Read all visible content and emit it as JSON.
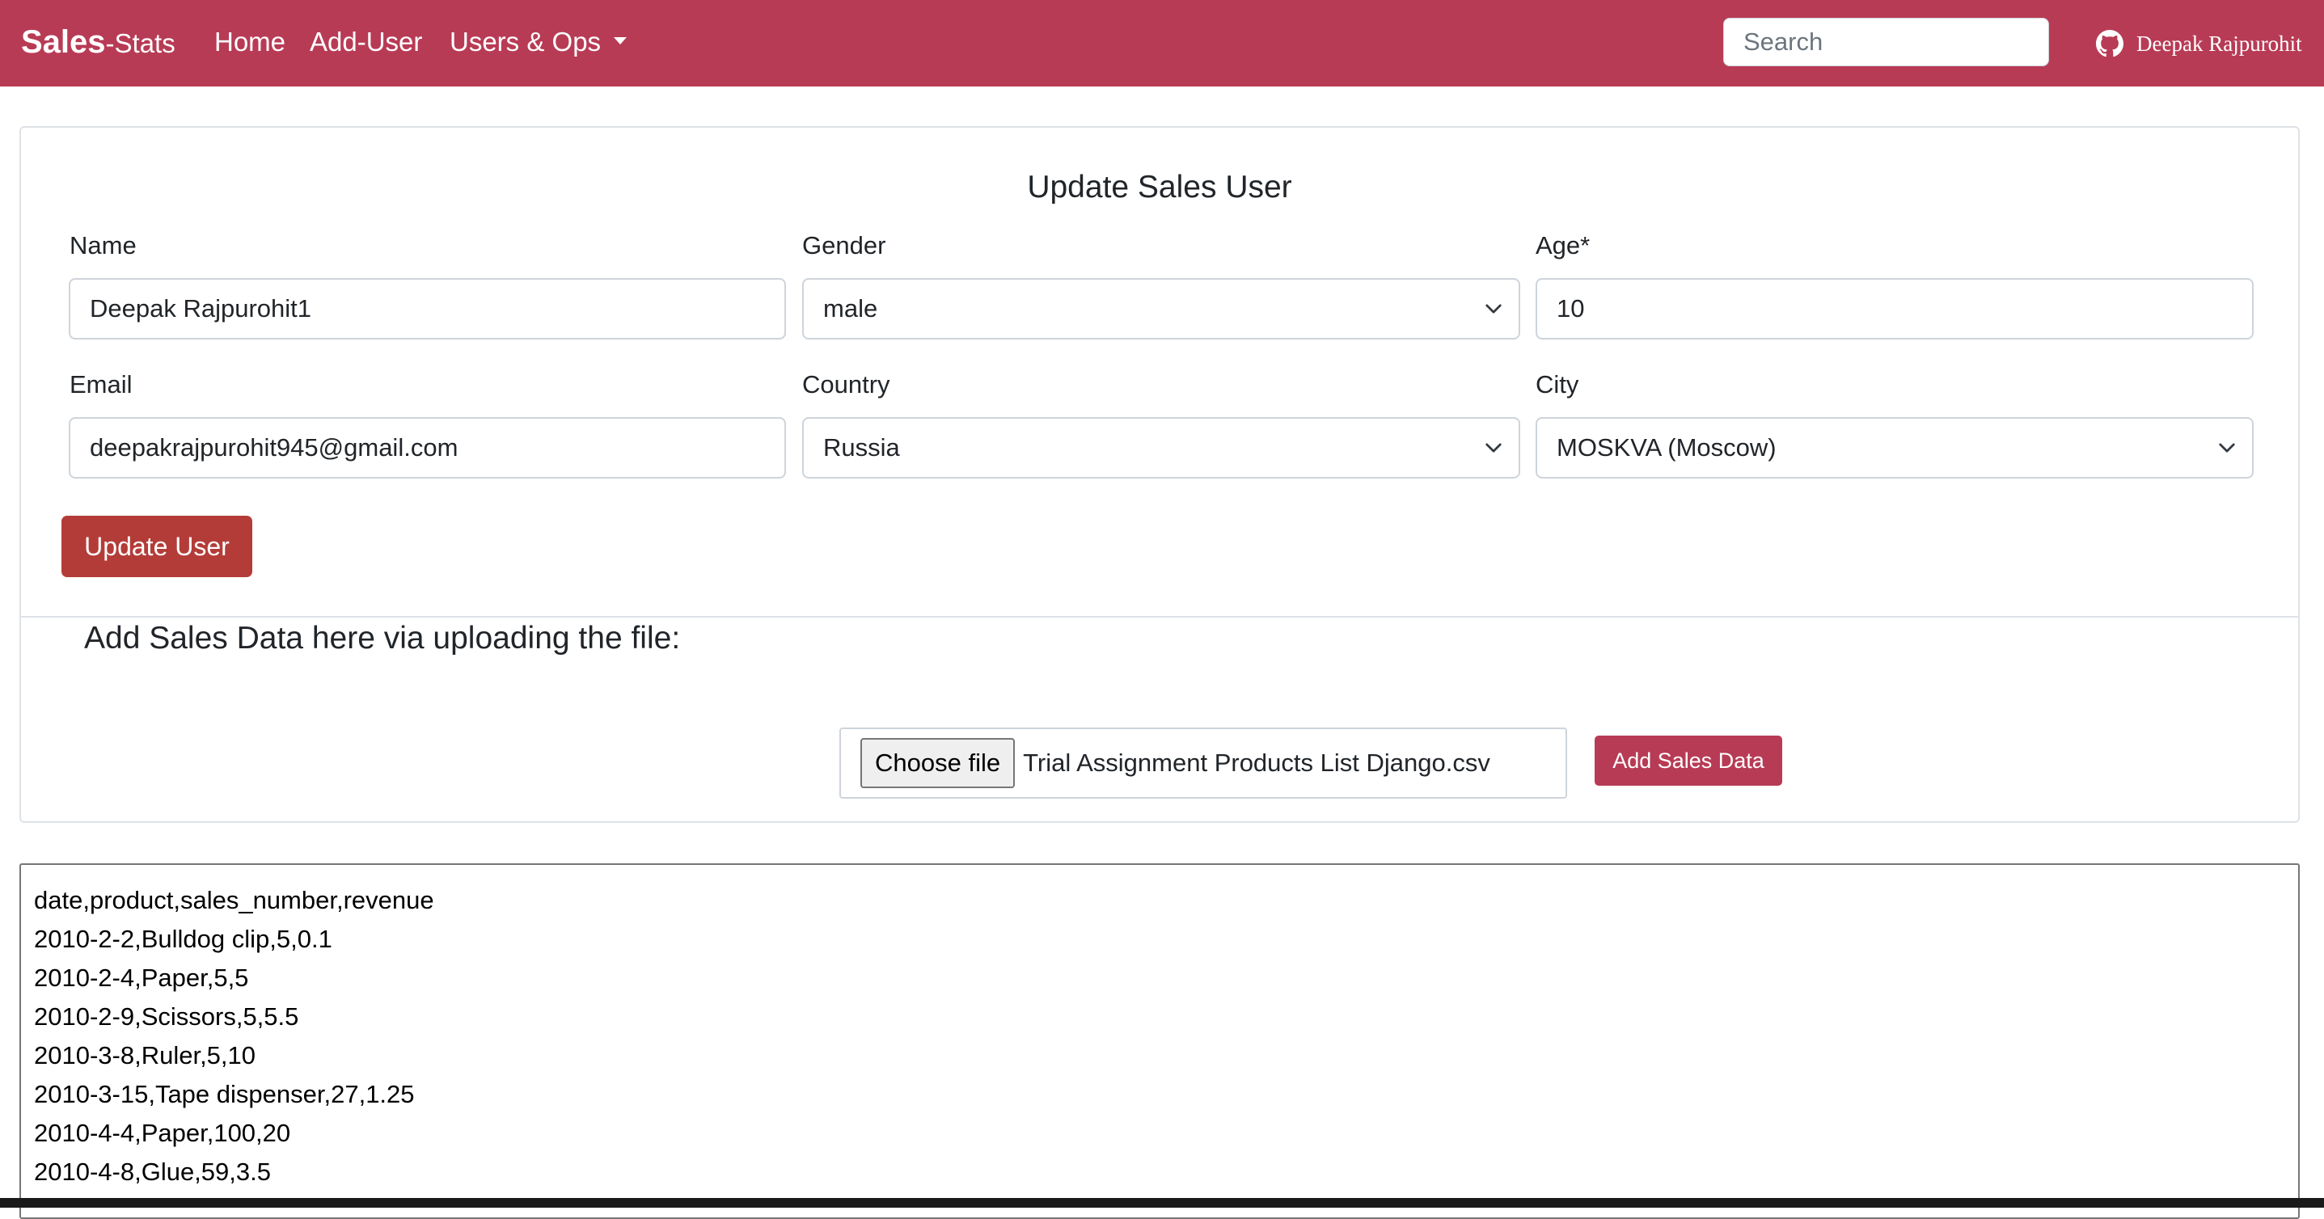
{
  "navbar": {
    "brand_bold": "Sales",
    "brand_rest": "-Stats",
    "links": [
      "Home",
      "Add-User",
      "Users & Ops"
    ],
    "search_placeholder": "Search",
    "github_user": "Deepak Rajpurohit",
    "color": "#b83b55"
  },
  "form": {
    "title": "Update Sales User",
    "name_label": "Name",
    "name_value": "Deepak Rajpurohit1",
    "gender_label": "Gender",
    "gender_value": "male",
    "age_label": "Age*",
    "age_value": "10",
    "email_label": "Email",
    "email_value": "deepakrajpurohit945@gmail.com",
    "country_label": "Country",
    "country_value": "Russia",
    "city_label": "City",
    "city_value": "MOSKVA (Moscow)",
    "update_button": "Update User",
    "update_button_color": "#b43c38"
  },
  "upload": {
    "label": "Add Sales Data here via uploading the file:",
    "choose_button": "Choose file",
    "file_name": "Trial Assignment Products List Django.csv",
    "submit_button": "Add Sales Data"
  },
  "data_lines": [
    "date,product,sales_number,revenue",
    "2010-2-2,Bulldog clip,5,0.1",
    "2010-2-4,Paper,5,5",
    "2010-2-9,Scissors,5,5.5",
    "2010-3-8,Ruler,5,10",
    "2010-3-15,Tape dispenser,27,1.25",
    "2010-4-4,Paper,100,20",
    "2010-4-8,Glue,59,3.5"
  ]
}
